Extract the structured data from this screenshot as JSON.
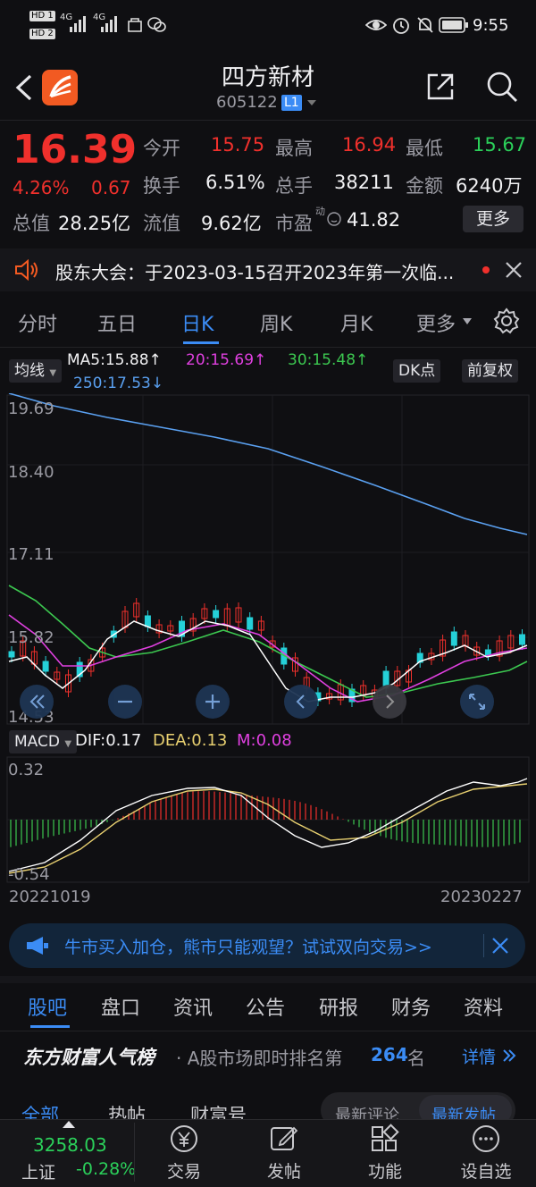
{
  "status_bar": {
    "hd1": "HD 1",
    "hd2": "HD 2",
    "net1": "4G",
    "net2": "4G",
    "time": "9:55"
  },
  "header": {
    "title": "四方新材",
    "code": "605122",
    "level_badge": "L1"
  },
  "quote": {
    "price": "16.39",
    "change_pct": "4.26%",
    "change_amt": "0.67",
    "open_label": "今开",
    "open": "15.75",
    "high_label": "最高",
    "high": "16.94",
    "low_label": "最低",
    "low": "15.67",
    "turnover_label": "换手",
    "turnover": "6.51%",
    "volume_label": "总手",
    "volume": "38211",
    "amount_label": "金额",
    "amount": "6240万",
    "mktcap_label": "总值",
    "mktcap": "28.25亿",
    "float_label": "流值",
    "float": "9.62亿",
    "pe_label": "市盈",
    "pe_sup": "动",
    "pe": "41.82",
    "more_label": "更多"
  },
  "notice": {
    "text": "股东大会：于2023-03-15召开2023年第一次临..."
  },
  "period_tabs": [
    {
      "label": "分时"
    },
    {
      "label": "五日"
    },
    {
      "label": "日K"
    },
    {
      "label": "周K"
    },
    {
      "label": "月K"
    },
    {
      "label": "更多"
    }
  ],
  "chart_header": {
    "ma_select": "均线",
    "ma5": "MA5:15.88↑",
    "ma20": "20:15.69↑",
    "ma30": "30:15.48↑",
    "ma250": "250:17.53↓",
    "dk_label": "DK点",
    "adjust_label": "前复权"
  },
  "price_axis": [
    "19.69",
    "18.40",
    "17.11",
    "15.82",
    "14.53"
  ],
  "macd": {
    "select": "MACD",
    "dif": "DIF:0.17",
    "dea": "DEA:0.13",
    "m": "M:0.08",
    "top": "0.32",
    "bottom": "-0.54"
  },
  "dates": {
    "start": "20221019",
    "end": "20230227"
  },
  "colors": {
    "up": "#f0302c",
    "down": "#25d0d8",
    "ma5": "#ffffff",
    "ma20": "#e040e0",
    "ma30": "#3cc850",
    "ma250": "#5aa0f0",
    "dea": "#e8d070",
    "accent": "#3b8cf5"
  },
  "banner": {
    "text": "牛市买入加仓，熊市只能观望？试试双向交易>>"
  },
  "bottom_tabs": [
    {
      "label": "股吧"
    },
    {
      "label": "盘口"
    },
    {
      "label": "资讯"
    },
    {
      "label": "公告"
    },
    {
      "label": "研报"
    },
    {
      "label": "财务"
    },
    {
      "label": "资料"
    }
  ],
  "popularity": {
    "brand": "东方财富人气榜",
    "text": "· A股市场即时排名第",
    "rank": "264",
    "suffix": "名",
    "detail": "详情"
  },
  "sub_tabs": {
    "all": "全部",
    "hot": "热帖",
    "wealth": "财富号",
    "latest_comment": "最新评论",
    "latest_post": "最新发帖"
  },
  "bottom_nav": {
    "index_value": "3258.03",
    "index_name": "上证",
    "index_change": "-0.28%",
    "trade": "交易",
    "post": "发帖",
    "function": "功能",
    "watchlist": "设自选"
  }
}
